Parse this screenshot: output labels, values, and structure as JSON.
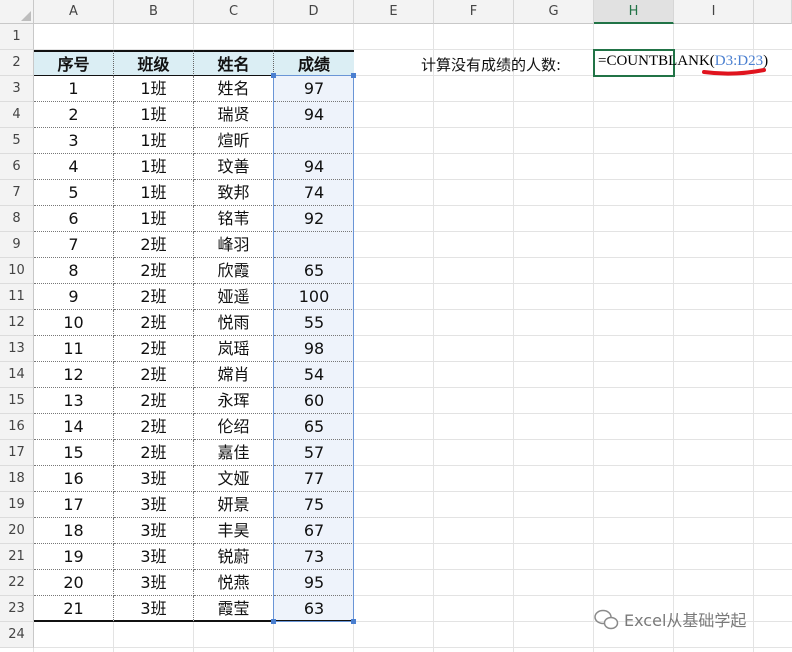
{
  "columns": [
    "A",
    "B",
    "C",
    "D",
    "E",
    "F",
    "G",
    "H",
    "I"
  ],
  "selected_column": "H",
  "rows": [
    "1",
    "2",
    "3",
    "4",
    "5",
    "6",
    "7",
    "8",
    "9",
    "10",
    "11",
    "12",
    "13",
    "14",
    "15",
    "16",
    "17",
    "18",
    "19",
    "20",
    "21",
    "22",
    "23",
    "24"
  ],
  "table": {
    "headers": [
      "序号",
      "班级",
      "姓名",
      "成绩"
    ],
    "records": [
      [
        "1",
        "1班",
        "姓名",
        "97"
      ],
      [
        "2",
        "1班",
        "瑞贤",
        "94"
      ],
      [
        "3",
        "1班",
        "煊昕",
        ""
      ],
      [
        "4",
        "1班",
        "玟善",
        "94"
      ],
      [
        "5",
        "1班",
        "致邦",
        "74"
      ],
      [
        "6",
        "1班",
        "铭苇",
        "92"
      ],
      [
        "7",
        "2班",
        "峰羽",
        ""
      ],
      [
        "8",
        "2班",
        "欣霞",
        "65"
      ],
      [
        "9",
        "2班",
        "娅遥",
        "100"
      ],
      [
        "10",
        "2班",
        "悦雨",
        "55"
      ],
      [
        "11",
        "2班",
        "岚瑶",
        "98"
      ],
      [
        "12",
        "2班",
        "嫦肖",
        "54"
      ],
      [
        "13",
        "2班",
        "永珲",
        "60"
      ],
      [
        "14",
        "2班",
        "伦绍",
        "65"
      ],
      [
        "15",
        "2班",
        "嘉佳",
        "57"
      ],
      [
        "16",
        "3班",
        "文娅",
        "77"
      ],
      [
        "17",
        "3班",
        "妍景",
        "75"
      ],
      [
        "18",
        "3班",
        "丰昊",
        "67"
      ],
      [
        "19",
        "3班",
        "锐蔚",
        "73"
      ],
      [
        "20",
        "3班",
        "悦燕",
        "95"
      ],
      [
        "21",
        "3班",
        "霞莹",
        "63"
      ]
    ]
  },
  "prompt_label": "计算没有成绩的人数:",
  "formula": {
    "prefix": "=COUNTBLANK(",
    "reference": "D3:D23",
    "suffix": ")"
  },
  "colors": {
    "header_fill": "#dbeef4",
    "score_fill": "#eef3fb",
    "selection": "#217346",
    "reference": "#4a7fd0",
    "underline": "#e0141e"
  },
  "watermark": "Excel从基础学起"
}
